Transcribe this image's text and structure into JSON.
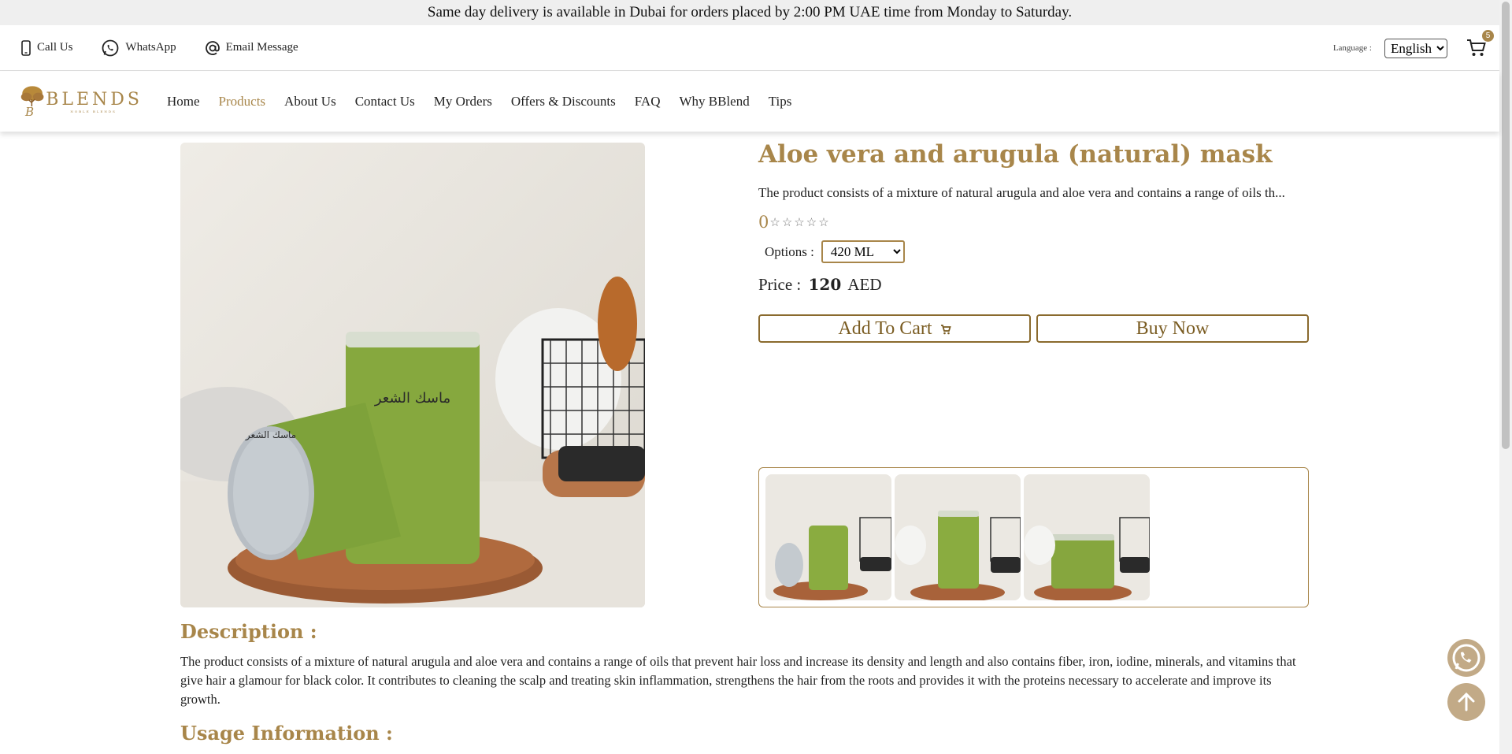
{
  "announcement": "Same day delivery is available in Dubai for orders placed by 2:00 PM UAE time from Monday to Saturday.",
  "topbar": {
    "call": "Call Us",
    "whatsapp": "WhatsApp",
    "email": "Email Message",
    "language_label": "Language :",
    "language_value": "English",
    "cart_count": "5"
  },
  "logo": {
    "name": "BLENDS",
    "tagline": "NOBLE BLENDS"
  },
  "nav": [
    "Home",
    "Products",
    "About Us",
    "Contact Us",
    "My Orders",
    "Offers & Discounts",
    "FAQ",
    "Why BBlend",
    "Tips"
  ],
  "nav_active": "Products",
  "product": {
    "title": "Aloe vera and arugula (natural) mask",
    "short_description": "The product consists of a mixture of natural arugula and aloe vera and contains a range of oils th...",
    "rating": "0",
    "rating_stars_filled": 0,
    "rating_stars_total": 5,
    "options_label": "Options :",
    "option_selected": "420 ML",
    "price_label": "Price :",
    "price_value": "120",
    "currency": "AED",
    "add_to_cart": "Add To Cart",
    "buy_now": "Buy Now",
    "thumbnail_count": 3
  },
  "description": {
    "heading": "Description :",
    "body": "The product consists of a mixture of natural arugula and aloe vera and contains a range of oils that prevent hair loss and increase its density and length and also contains fiber, iron, iodine, minerals, and vitamins that give hair a glamour for black color. It contributes to cleaning the scalp and treating skin inflammation, strengthens the hair from the roots and provides it with the proteins necessary to accelerate and improve its growth."
  },
  "usage": {
    "heading": "Usage Information :"
  },
  "colors": {
    "brand": "#a8864a",
    "announcement_bg": "#efefef",
    "fab": "#c2aa87"
  },
  "icons": [
    "phone-icon",
    "whatsapp-icon",
    "at-sign-icon",
    "cart-icon",
    "whatsapp-float-icon",
    "arrow-up-icon"
  ]
}
